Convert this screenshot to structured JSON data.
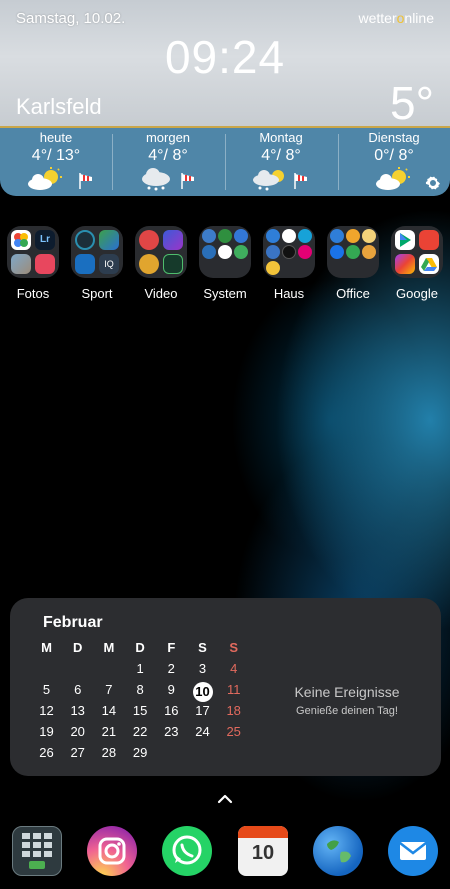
{
  "weather": {
    "date": "Samstag, 10.02.",
    "brand_left": "wetter",
    "brand_o": "o",
    "brand_right": "nline",
    "time": "09:24",
    "city": "Karlsfeld",
    "temperature": "5°",
    "days": [
      {
        "name": "heute",
        "range": "4°/ 13°",
        "icon": "sun-cloud-icon"
      },
      {
        "name": "morgen",
        "range": "4°/ 8°",
        "icon": "cloud-rain-icon"
      },
      {
        "name": "Montag",
        "range": "4°/ 8°",
        "icon": "sun-cloud-rain-icon"
      },
      {
        "name": "Dienstag",
        "range": "0°/ 8°",
        "icon": "sun-cloud-icon"
      }
    ],
    "settings_icon": "gear-icon"
  },
  "folders": [
    {
      "label": "Fotos"
    },
    {
      "label": "Sport"
    },
    {
      "label": "Video"
    },
    {
      "label": "System"
    },
    {
      "label": "Haus"
    },
    {
      "label": "Office"
    },
    {
      "label": "Google"
    }
  ],
  "calendar": {
    "month": "Februar",
    "weekdays": [
      "M",
      "D",
      "M",
      "D",
      "F",
      "S",
      "S"
    ],
    "weeks": [
      [
        "",
        "",
        "",
        "1",
        "2",
        "3",
        "4"
      ],
      [
        "5",
        "6",
        "7",
        "8",
        "9",
        "10",
        "11"
      ],
      [
        "12",
        "13",
        "14",
        "15",
        "16",
        "17",
        "18"
      ],
      [
        "19",
        "20",
        "21",
        "22",
        "23",
        "24",
        "25"
      ],
      [
        "26",
        "27",
        "28",
        "29",
        "",
        "",
        ""
      ]
    ],
    "today": "10",
    "no_events": "Keine Ereignisse",
    "no_events_sub": "Genieße deinen Tag!"
  },
  "dock": {
    "calendar_day": "10",
    "apps": [
      "phone-dialer-icon",
      "instagram-icon",
      "whatsapp-icon",
      "calendar-icon",
      "globe-icon",
      "mail-icon"
    ]
  },
  "colors": {
    "weather_bar": "#4f86a8",
    "weekend_red": "#e26a5e",
    "calendar_bg": "#2c2d30"
  }
}
